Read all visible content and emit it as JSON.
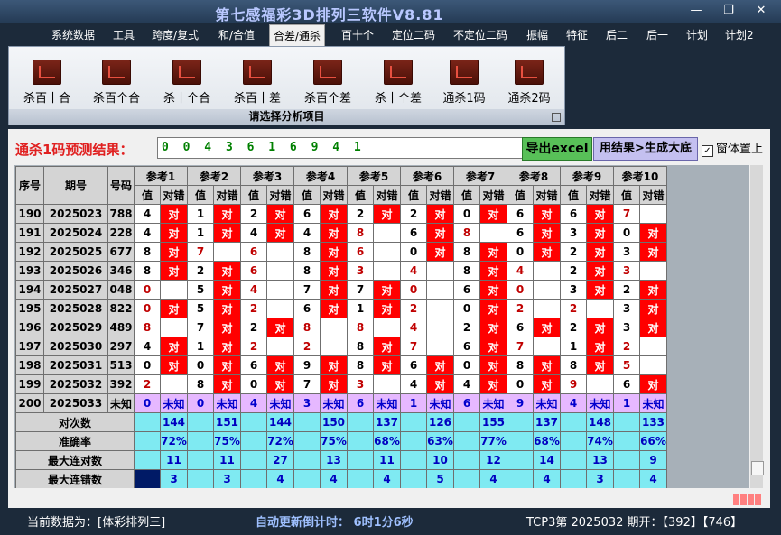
{
  "window": {
    "title": "第七感福彩3D排列三软件V8.81",
    "min": "—",
    "restore": "❐",
    "close": "✕"
  },
  "menu": [
    "系统数据",
    "工具",
    "跨度/复式",
    "和/合值",
    "合差/通杀",
    "百十个",
    "定位二码",
    "不定位二码",
    "振幅",
    "特征",
    "后二",
    "后一",
    "计划",
    "计划2"
  ],
  "menu_active": "合差/通杀",
  "ribbon": {
    "buttons": [
      "杀百十合",
      "杀百个合",
      "杀十个合",
      "杀百十差",
      "杀百个差",
      "杀十个差",
      "通杀1码",
      "通杀2码"
    ],
    "caption": "请选择分析项目"
  },
  "prediction": {
    "label": "通杀1码预测结果：",
    "value": "0 0 4 3 6 1 6 9 4 1",
    "excel_button": "导出excel",
    "generate_button": "用结果>生成大底",
    "topmost_label": "窗体置上",
    "topmost_checked": "✓"
  },
  "table": {
    "headers": {
      "seq": "序号",
      "issue": "期号",
      "code": "号码",
      "value": "值",
      "check": "对错"
    },
    "refs": [
      "参考1",
      "参考2",
      "参考3",
      "参考4",
      "参考5",
      "参考6",
      "参考7",
      "参考8",
      "参考9",
      "参考10"
    ],
    "hit_text": "对",
    "rows": [
      {
        "seq": "190",
        "issue": "2025023",
        "code": "788",
        "v": [
          "4",
          "1",
          "2",
          "6",
          "2",
          "2",
          "0",
          "6",
          "6",
          "7"
        ],
        "h": [
          1,
          1,
          1,
          1,
          1,
          1,
          1,
          1,
          1,
          0
        ]
      },
      {
        "seq": "191",
        "issue": "2025024",
        "code": "228",
        "v": [
          "4",
          "1",
          "4",
          "4",
          "8",
          "6",
          "8",
          "6",
          "3",
          "0"
        ],
        "h": [
          1,
          1,
          1,
          1,
          0,
          1,
          0,
          1,
          1,
          1
        ]
      },
      {
        "seq": "192",
        "issue": "2025025",
        "code": "677",
        "v": [
          "8",
          "7",
          "6",
          "8",
          "6",
          "0",
          "8",
          "0",
          "2",
          "3"
        ],
        "h": [
          1,
          0,
          0,
          1,
          0,
          1,
          1,
          1,
          1,
          1
        ]
      },
      {
        "seq": "193",
        "issue": "2025026",
        "code": "346",
        "v": [
          "8",
          "2",
          "6",
          "8",
          "3",
          "4",
          "8",
          "4",
          "2",
          "3"
        ],
        "h": [
          1,
          1,
          0,
          1,
          0,
          0,
          1,
          0,
          1,
          0
        ]
      },
      {
        "seq": "194",
        "issue": "2025027",
        "code": "048",
        "v": [
          "0",
          "5",
          "4",
          "7",
          "7",
          "0",
          "6",
          "0",
          "3",
          "2"
        ],
        "h": [
          0,
          1,
          0,
          1,
          1,
          0,
          1,
          0,
          1,
          1
        ]
      },
      {
        "seq": "195",
        "issue": "2025028",
        "code": "822",
        "v": [
          "0",
          "5",
          "2",
          "6",
          "1",
          "2",
          "0",
          "2",
          "2",
          "3"
        ],
        "h": [
          1,
          1,
          0,
          1,
          1,
          0,
          1,
          0,
          0,
          1
        ]
      },
      {
        "seq": "196",
        "issue": "2025029",
        "code": "489",
        "v": [
          "8",
          "7",
          "2",
          "8",
          "8",
          "4",
          "2",
          "6",
          "2",
          "3"
        ],
        "h": [
          0,
          1,
          1,
          0,
          0,
          0,
          1,
          1,
          1,
          1
        ]
      },
      {
        "seq": "197",
        "issue": "2025030",
        "code": "297",
        "v": [
          "4",
          "1",
          "2",
          "2",
          "8",
          "7",
          "6",
          "7",
          "1",
          "2"
        ],
        "h": [
          1,
          1,
          0,
          0,
          1,
          0,
          1,
          0,
          1,
          0
        ]
      },
      {
        "seq": "198",
        "issue": "2025031",
        "code": "513",
        "v": [
          "0",
          "0",
          "6",
          "9",
          "8",
          "6",
          "0",
          "8",
          "8",
          "5"
        ],
        "h": [
          1,
          1,
          1,
          1,
          1,
          1,
          1,
          1,
          1,
          0
        ]
      },
      {
        "seq": "199",
        "issue": "2025032",
        "code": "392",
        "v": [
          "2",
          "8",
          "0",
          "7",
          "3",
          "4",
          "4",
          "0",
          "9",
          "6"
        ],
        "h": [
          0,
          1,
          1,
          1,
          0,
          1,
          1,
          1,
          0,
          1
        ]
      }
    ],
    "red_values": [
      [
        0,
        0,
        0,
        0,
        0,
        0,
        0,
        0,
        0,
        1
      ],
      [
        0,
        0,
        0,
        0,
        1,
        0,
        1,
        0,
        0,
        0
      ],
      [
        0,
        1,
        1,
        0,
        1,
        0,
        0,
        0,
        0,
        0
      ],
      [
        0,
        0,
        1,
        0,
        1,
        1,
        0,
        1,
        0,
        1
      ],
      [
        1,
        0,
        1,
        0,
        0,
        1,
        0,
        1,
        0,
        0
      ],
      [
        1,
        0,
        1,
        0,
        0,
        1,
        0,
        1,
        1,
        0
      ],
      [
        1,
        0,
        0,
        1,
        1,
        1,
        0,
        0,
        0,
        0
      ],
      [
        0,
        0,
        1,
        1,
        0,
        1,
        0,
        1,
        0,
        1
      ],
      [
        0,
        0,
        0,
        0,
        0,
        0,
        0,
        0,
        0,
        1
      ],
      [
        1,
        0,
        0,
        0,
        1,
        0,
        0,
        0,
        1,
        0
      ]
    ],
    "pending": {
      "seq": "200",
      "issue": "2025033",
      "code": "未知",
      "v": [
        "0",
        "0",
        "4",
        "3",
        "6",
        "1",
        "6",
        "9",
        "4",
        "1"
      ],
      "label": "未知"
    },
    "stats": [
      {
        "label": "对次数",
        "values": [
          "144",
          "151",
          "144",
          "150",
          "137",
          "126",
          "155",
          "137",
          "148",
          "133"
        ]
      },
      {
        "label": "准确率",
        "values": [
          "72%",
          "75%",
          "72%",
          "75%",
          "68%",
          "63%",
          "77%",
          "68%",
          "74%",
          "66%"
        ]
      },
      {
        "label": "最大连对数",
        "values": [
          "11",
          "11",
          "27",
          "13",
          "11",
          "10",
          "12",
          "14",
          "13",
          "9"
        ]
      },
      {
        "label": "最大连错数",
        "values": [
          "3",
          "3",
          "4",
          "4",
          "4",
          "5",
          "4",
          "4",
          "3",
          "4"
        ]
      }
    ]
  },
  "status": {
    "current": "当前数据为：[体彩排列三]",
    "countdown": "自动更新倒计时：  6时1分6秒",
    "latest": "TCP3第 2025032 期开：【392】【746】"
  },
  "colors": {
    "hit": "#ff0000",
    "pending": "#e6b8ff",
    "stat": "#7feaf2",
    "dark": "#001a66"
  }
}
